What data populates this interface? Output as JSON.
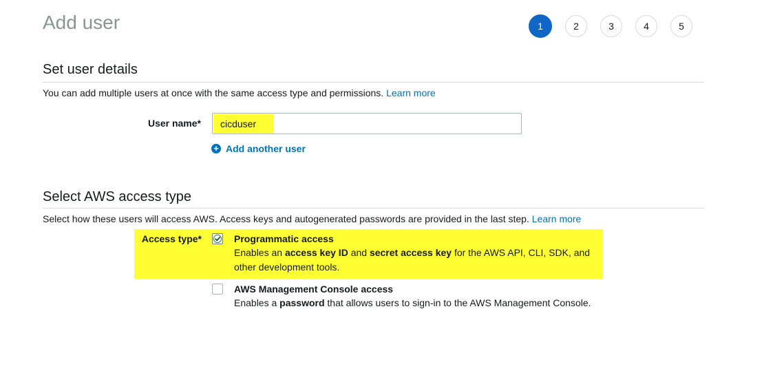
{
  "header": {
    "title": "Add user"
  },
  "steps": [
    "1",
    "2",
    "3",
    "4",
    "5"
  ],
  "active_step": "1",
  "colors": {
    "accent": "#0f66c4",
    "link": "#0073bb",
    "highlight": "#ffff33"
  },
  "user_details": {
    "title": "Set user details",
    "description": "You can add multiple users at once with the same access type and permissions.",
    "learn_more": "Learn more",
    "username_label": "User name*",
    "username_value": "cicduser",
    "add_another": "Add another user",
    "add_icon": "plus-circle-icon"
  },
  "access_type": {
    "title": "Select AWS access type",
    "description": "Select how these users will access AWS. Access keys and autogenerated passwords are provided in the last step.",
    "learn_more": "Learn more",
    "label": "Access type*",
    "programmatic": {
      "title": "Programmatic access",
      "checked": true,
      "desc_1": "Enables an ",
      "desc_bold_1": "access key ID",
      "desc_2": " and ",
      "desc_bold_2": "secret access key",
      "desc_3": " for the AWS API, CLI, SDK, and other development tools."
    },
    "console": {
      "title": "AWS Management Console access",
      "checked": false,
      "desc_1": "Enables a ",
      "desc_bold_1": "password",
      "desc_2": " that allows users to sign-in to the AWS Management Console."
    }
  }
}
